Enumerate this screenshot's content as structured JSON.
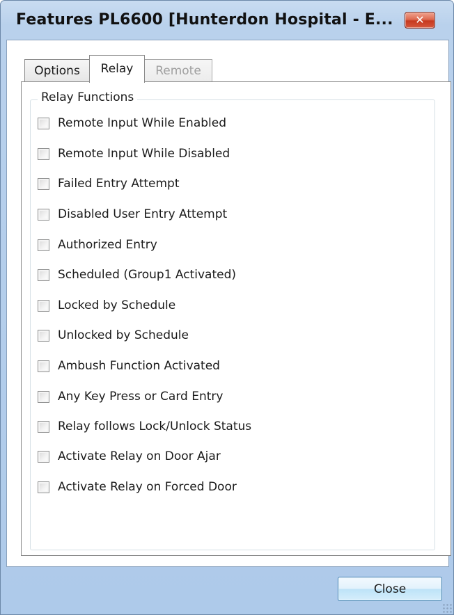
{
  "window": {
    "title": "Features PL6600 [Hunterdon Hospital - E...",
    "close_glyph": "✕"
  },
  "tabs": [
    {
      "label": "Options",
      "state": "normal"
    },
    {
      "label": "Relay",
      "state": "selected"
    },
    {
      "label": "Remote",
      "state": "disabled"
    }
  ],
  "relay_group": {
    "legend": "Relay Functions",
    "items": [
      {
        "label": "Remote Input While Enabled",
        "checked": false
      },
      {
        "label": "Remote Input While Disabled",
        "checked": false
      },
      {
        "label": "Failed Entry Attempt",
        "checked": false
      },
      {
        "label": "Disabled User Entry Attempt",
        "checked": false
      },
      {
        "label": "Authorized Entry",
        "checked": false
      },
      {
        "label": "Scheduled (Group1 Activated)",
        "checked": false
      },
      {
        "label": "Locked by Schedule",
        "checked": false
      },
      {
        "label": "Unlocked by Schedule",
        "checked": false
      },
      {
        "label": "Ambush Function Activated",
        "checked": false
      },
      {
        "label": "Any Key Press or Card Entry",
        "checked": false
      },
      {
        "label": "Relay follows Lock/Unlock Status",
        "checked": false
      },
      {
        "label": "Activate Relay on Door Ajar",
        "checked": false
      },
      {
        "label": "Activate Relay on Forced Door",
        "checked": false
      }
    ]
  },
  "footer": {
    "close_label": "Close"
  },
  "colors": {
    "titlebar": "#b9d1ec",
    "close_accent": "#c6391f",
    "button_border": "#3c7fb1"
  }
}
